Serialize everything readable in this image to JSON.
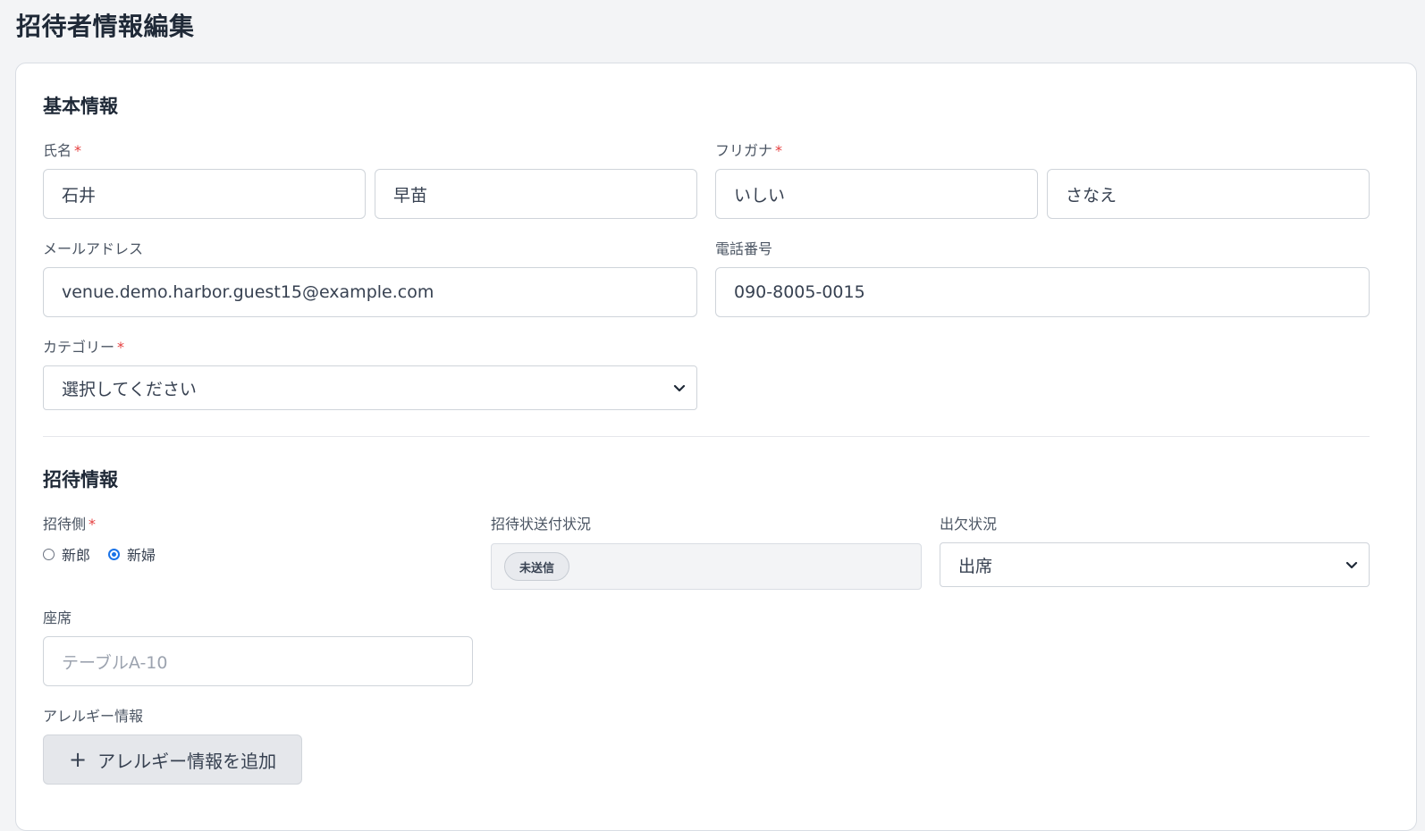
{
  "page": {
    "title": "招待者情報編集"
  },
  "basic": {
    "section_title": "基本情報",
    "name": {
      "label": "氏名",
      "required": "*",
      "last_name": "石井",
      "first_name": "早苗"
    },
    "kana": {
      "label": "フリガナ",
      "required": "*",
      "last_kana": "いしい",
      "first_kana": "さなえ"
    },
    "email": {
      "label": "メールアドレス",
      "value": "venue.demo.harbor.guest15@example.com"
    },
    "phone": {
      "label": "電話番号",
      "value": "090-8005-0015"
    },
    "category": {
      "label": "カテゴリー",
      "required": "*",
      "selected": "選択してください"
    }
  },
  "invitation": {
    "section_title": "招待情報",
    "side": {
      "label": "招待側",
      "required": "*",
      "options": [
        "新郎",
        "新婦"
      ],
      "selected": "新婦"
    },
    "send_status": {
      "label": "招待状送付状況",
      "badge": "未送信"
    },
    "attendance": {
      "label": "出欠状況",
      "selected": "出席"
    },
    "seat": {
      "label": "座席",
      "placeholder": "テーブルA-10",
      "value": ""
    },
    "allergy": {
      "label": "アレルギー情報",
      "add_button": "アレルギー情報を追加"
    }
  },
  "icons": {
    "select_chevron": "chevron-down-icon",
    "add": "plus-icon"
  },
  "colors": {
    "required_mark": "#e53e3e",
    "radio_checked": "#1a73e8",
    "background": "#f3f4f6"
  }
}
